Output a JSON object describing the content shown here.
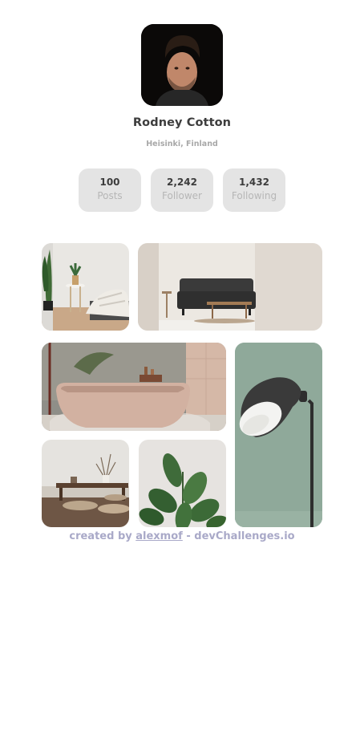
{
  "profile": {
    "name": "Rodney Cotton",
    "location": "Heisinki, Finland"
  },
  "stats": [
    {
      "value": "100",
      "label": "Posts"
    },
    {
      "value": "2,242",
      "label": "Follower"
    },
    {
      "value": "1,432",
      "label": "Following"
    }
  ],
  "gallery": {
    "photos": [
      {
        "subject": "living-room-corner-with-plant"
      },
      {
        "subject": "dark-sofa-living-room"
      },
      {
        "subject": "pink-bathtub"
      },
      {
        "subject": "wall-lamp"
      },
      {
        "subject": "low-table-with-cushions"
      },
      {
        "subject": "rubber-plant"
      }
    ]
  },
  "footer": {
    "prefix": "created by ",
    "author": "alexmof",
    "suffix": " - devChallenges.io"
  },
  "colors": {
    "stat_bg": "#e4e4e4",
    "footer_text": "#a9a9c8",
    "name_text": "#3d3d3d"
  }
}
